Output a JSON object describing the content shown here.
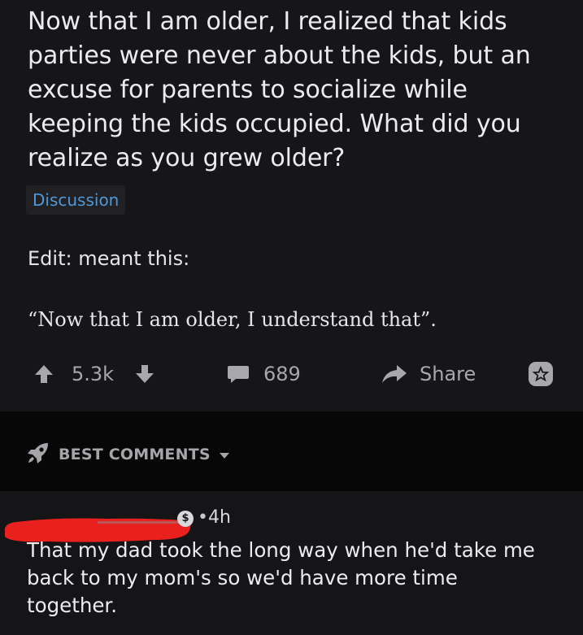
{
  "post": {
    "title": "Now that I am older, I realized that kids parties were never about the kids, but an excuse for parents to socialize while keeping the kids occupied. What did you realize as you grew older?",
    "flair": "Discussion",
    "body_edit": "Edit: meant this:",
    "body_quote": "“Now that I am older, I understand that”.",
    "actions": {
      "score": "5.3k",
      "comments_count": "689",
      "share_label": "Share"
    },
    "colors": {
      "flair_text": "#4f98d8",
      "background": "#161618",
      "action_gray": "#a8a8ac"
    }
  },
  "sort": {
    "label": "BEST COMMENTS",
    "icon": "rocket-icon"
  },
  "comment": {
    "timestamp": "4h",
    "separator": "•",
    "text": "That my dad took the long way when he'd take me back to my mom's so we'd have more time together.",
    "redaction_color": "#e8211e"
  }
}
